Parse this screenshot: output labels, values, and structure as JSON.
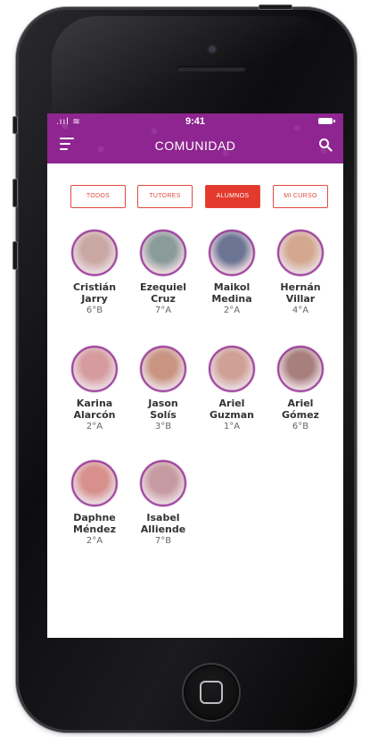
{
  "status_bar": {
    "signal": ".ııl ≋",
    "time": "9:41"
  },
  "header": {
    "title": "COMUNIDAD"
  },
  "tabs": [
    {
      "label": "TODOS",
      "active": false
    },
    {
      "label": "TUTORES",
      "active": false
    },
    {
      "label": "ALUMNOS",
      "active": true
    },
    {
      "label": "MI CURSO",
      "active": false
    }
  ],
  "members": [
    {
      "first": "Cristián",
      "last": "Jarry",
      "grade": "6°B",
      "avatar_color": "#c9a8a4"
    },
    {
      "first": "Ezequiel",
      "last": "Cruz",
      "grade": "7°A",
      "avatar_color": "#8a9c9a"
    },
    {
      "first": "Maikol",
      "last": "Medina",
      "grade": "2°A",
      "avatar_color": "#6c7594"
    },
    {
      "first": "Hernán",
      "last": "Villar",
      "grade": "4°A",
      "avatar_color": "#d3a88e"
    },
    {
      "first": "Karina",
      "last": "Alarcón",
      "grade": "2°A",
      "avatar_color": "#d69b9e"
    },
    {
      "first": "Jason",
      "last": "Solís",
      "grade": "3°B",
      "avatar_color": "#c99481"
    },
    {
      "first": "Ariel",
      "last": "Guzman",
      "grade": "1°A",
      "avatar_color": "#cfa095"
    },
    {
      "first": "Ariel",
      "last": "Gómez",
      "grade": "6°B",
      "avatar_color": "#a7807d"
    },
    {
      "first": "Daphne",
      "last": "Méndez",
      "grade": "2°A",
      "avatar_color": "#d8908d"
    },
    {
      "first": "Isabel",
      "last": "Alliende",
      "grade": "7°B",
      "avatar_color": "#c59aa0"
    }
  ],
  "colors": {
    "appbar": "#8e2590",
    "tab_accent": "#e4392d"
  }
}
